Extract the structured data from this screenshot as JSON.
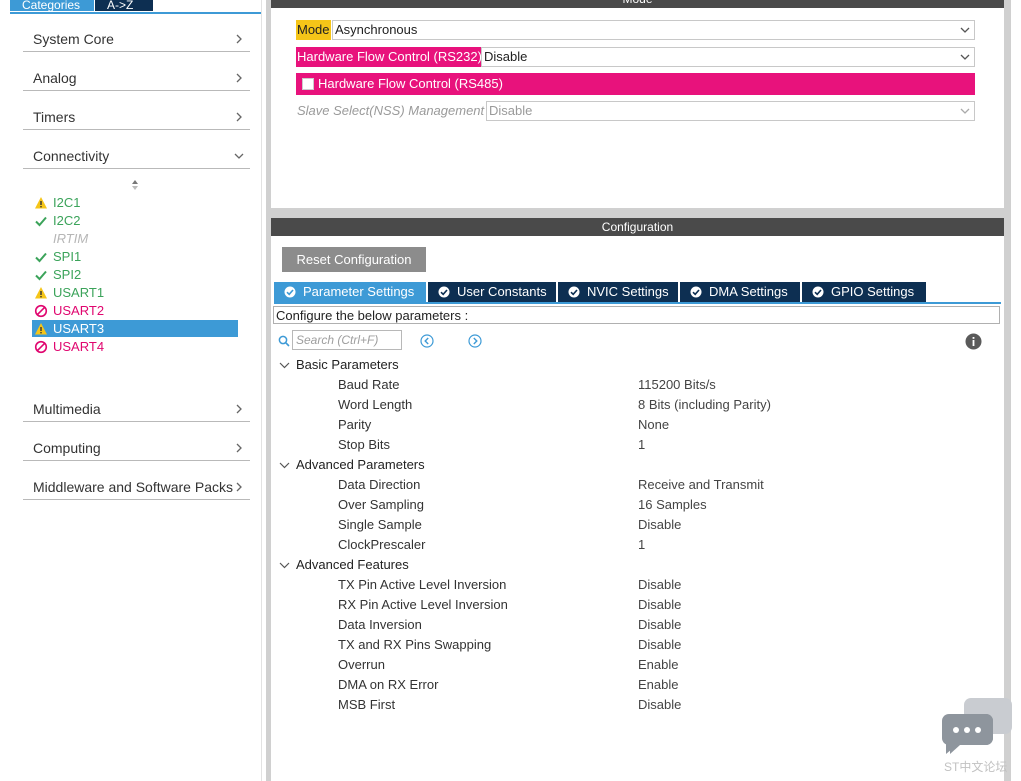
{
  "categories_tabs": {
    "categories": "Categories",
    "az": "A->Z"
  },
  "categories": [
    {
      "label": "System Core",
      "state": "collapsed"
    },
    {
      "label": "Analog",
      "state": "collapsed"
    },
    {
      "label": "Timers",
      "state": "collapsed"
    },
    {
      "label": "Connectivity",
      "state": "expanded"
    },
    {
      "label": "Multimedia",
      "state": "collapsed"
    },
    {
      "label": "Computing",
      "state": "collapsed"
    },
    {
      "label": "Middleware and Software Packs",
      "state": "collapsed"
    }
  ],
  "peripherals": [
    {
      "name": "I2C1",
      "status": "warning"
    },
    {
      "name": "I2C2",
      "status": "ok"
    },
    {
      "name": "IRTIM",
      "status": "disabled"
    },
    {
      "name": "SPI1",
      "status": "ok"
    },
    {
      "name": "SPI2",
      "status": "ok"
    },
    {
      "name": "USART1",
      "status": "warning"
    },
    {
      "name": "USART2",
      "status": "blocked"
    },
    {
      "name": "USART3",
      "status": "warning",
      "selected": true
    },
    {
      "name": "USART4",
      "status": "blocked"
    }
  ],
  "mode": {
    "header": "Mode",
    "mode_label": "Mode",
    "mode_value": "Asynchronous",
    "hfc_rs232_label": "Hardware Flow Control (RS232)",
    "hfc_rs232_value": "Disable",
    "hfc_rs485_label": "Hardware Flow Control (RS485)",
    "hfc_rs485_checked": false,
    "slave_select_label": "Slave Select(NSS) Management",
    "slave_select_value": "Disable"
  },
  "configuration": {
    "header": "Configuration",
    "reset_button": "Reset Configuration",
    "tabs": [
      {
        "label": "Parameter Settings",
        "active": true
      },
      {
        "label": "User Constants",
        "active": false
      },
      {
        "label": "NVIC Settings",
        "active": false
      },
      {
        "label": "DMA Settings",
        "active": false
      },
      {
        "label": "GPIO Settings",
        "active": false
      }
    ],
    "instruction": "Configure the below parameters :",
    "search_placeholder": "Search (Ctrl+F)",
    "groups": [
      {
        "label": "Basic Parameters",
        "params": [
          {
            "name": "Baud Rate",
            "value": "115200 Bits/s"
          },
          {
            "name": "Word Length",
            "value": "8 Bits (including Parity)"
          },
          {
            "name": "Parity",
            "value": "None"
          },
          {
            "name": "Stop Bits",
            "value": "1"
          }
        ]
      },
      {
        "label": "Advanced Parameters",
        "params": [
          {
            "name": "Data Direction",
            "value": "Receive and Transmit"
          },
          {
            "name": "Over Sampling",
            "value": "16 Samples"
          },
          {
            "name": "Single Sample",
            "value": "Disable"
          },
          {
            "name": "ClockPrescaler",
            "value": "1"
          }
        ]
      },
      {
        "label": "Advanced Features",
        "params": [
          {
            "name": "TX Pin Active Level Inversion",
            "value": "Disable"
          },
          {
            "name": "RX Pin Active Level Inversion",
            "value": "Disable"
          },
          {
            "name": "Data Inversion",
            "value": "Disable"
          },
          {
            "name": "TX and RX Pins Swapping",
            "value": "Disable"
          },
          {
            "name": "Overrun",
            "value": "Enable"
          },
          {
            "name": "DMA on RX Error",
            "value": "Enable"
          },
          {
            "name": "MSB First",
            "value": "Disable"
          }
        ]
      }
    ]
  },
  "watermark": "ST中文论坛",
  "colors": {
    "accent_blue": "#3d9ad6",
    "navy": "#0d2f52",
    "pink": "#e8127c",
    "mode_label_yellow": "#f5c518",
    "ok_green": "#3ba35a",
    "warn_yellow": "#f5c518"
  }
}
